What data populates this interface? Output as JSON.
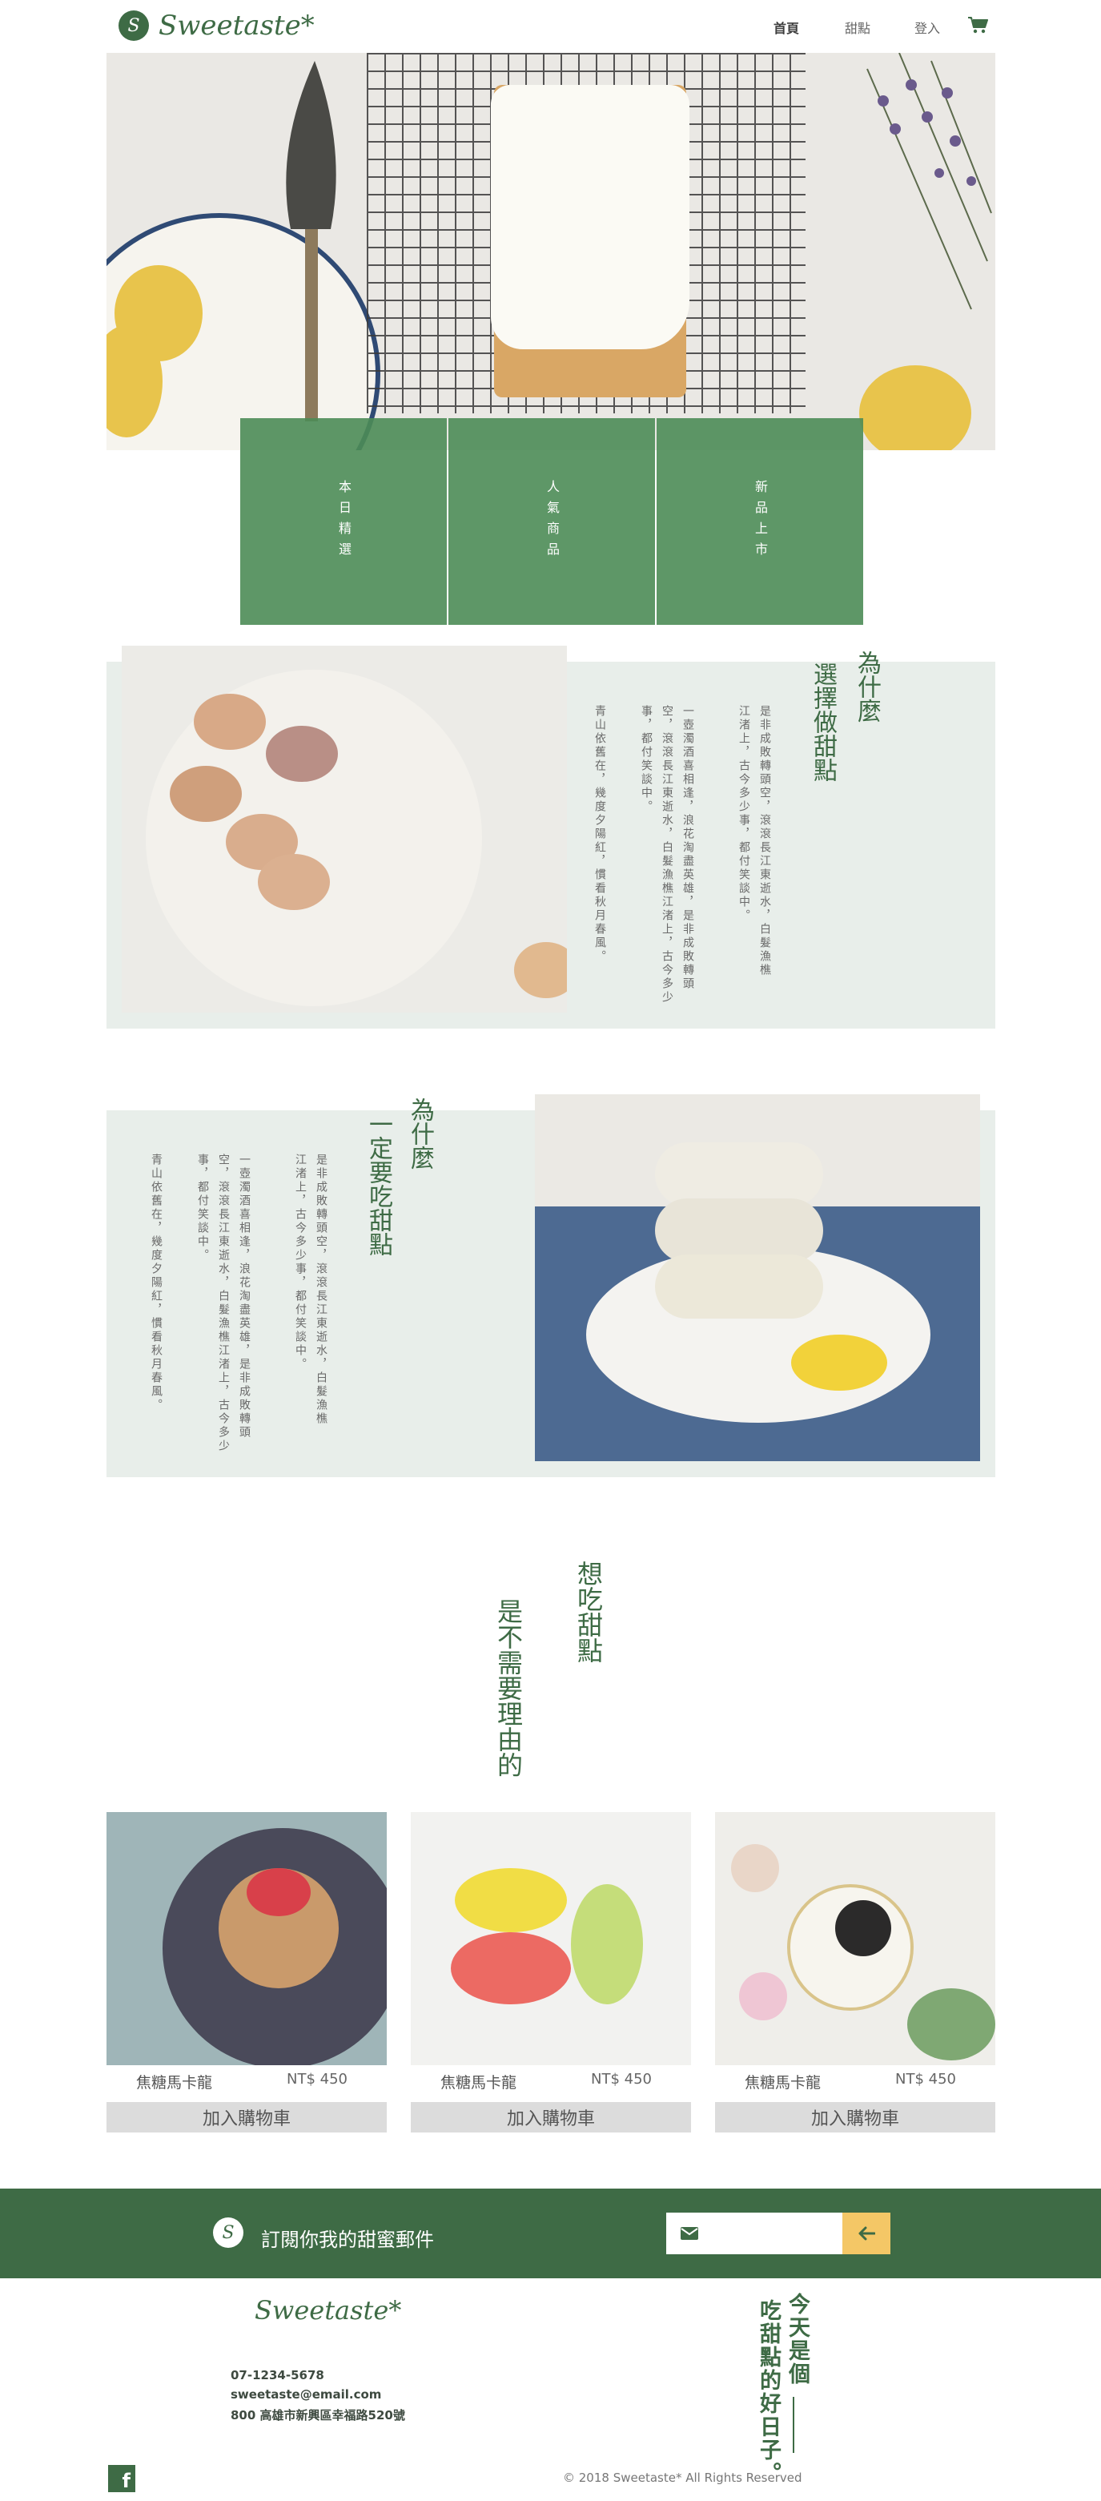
{
  "header": {
    "logo_letter": "S",
    "logo_text": "Sweetaste*",
    "nav": [
      "首頁",
      "甜點",
      "登入"
    ]
  },
  "hero_tiles": [
    "本日精選",
    "人氣商品",
    "新品上市"
  ],
  "section1": {
    "title_a": "為什麼",
    "title_b": "選擇做甜點",
    "paragraphs": [
      "是非成敗轉頭空，滾滾長江東逝水，白髮漁樵江渚上，古今多少事，都付笑談中。",
      "一壺濁酒喜相逢，浪花淘盡英雄，是非成敗轉頭空，滾滾長江東逝水，白髮漁樵江渚上，古今多少事，都付笑談中。",
      "青山依舊在，幾度夕陽紅，慣看秋月春風。"
    ]
  },
  "section2": {
    "title_a": "為什麼",
    "title_b": "一定要吃甜點",
    "paragraphs": [
      "是非成敗轉頭空，滾滾長江東逝水，白髮漁樵江渚上，古今多少事，都付笑談中。",
      "一壺濁酒喜相逢，浪花淘盡英雄，是非成敗轉頭空，滾滾長江東逝水，白髮漁樵江渚上，古今多少事，都付笑談中。",
      "青山依舊在，幾度夕陽紅，慣看秋月春風。"
    ]
  },
  "want_dessert": {
    "line1": "想吃甜點",
    "line2": "是不需要理由的"
  },
  "products": [
    {
      "name": "焦糖馬卡龍",
      "price": "NT$ 450",
      "button": "加入購物車"
    },
    {
      "name": "焦糖馬卡龍",
      "price": "NT$ 450",
      "button": "加入購物車"
    },
    {
      "name": "焦糖馬卡龍",
      "price": "NT$ 450",
      "button": "加入購物車"
    }
  ],
  "subscribe": {
    "text": "訂閱你我的甜蜜郵件",
    "placeholder": ""
  },
  "footer": {
    "logo_text": "Sweetaste*",
    "phone": "07-1234-5678",
    "email": "sweetaste@email.com",
    "address": "800 高雄市新興區幸福路520號",
    "slogan_a": "今天是個",
    "slogan_b": "吃甜點的好日子。",
    "copyright": "© 2018 Sweetaste* All Rights Reserved",
    "fb": "f"
  },
  "colors": {
    "brand_green": "#3e6b45",
    "tile_green": "#4c8c56",
    "panel_bg": "#e8eeea",
    "accent_yellow": "#f4c766"
  },
  "icons": [
    "cart-icon",
    "mail-icon",
    "arrow-left-icon",
    "facebook-icon"
  ]
}
